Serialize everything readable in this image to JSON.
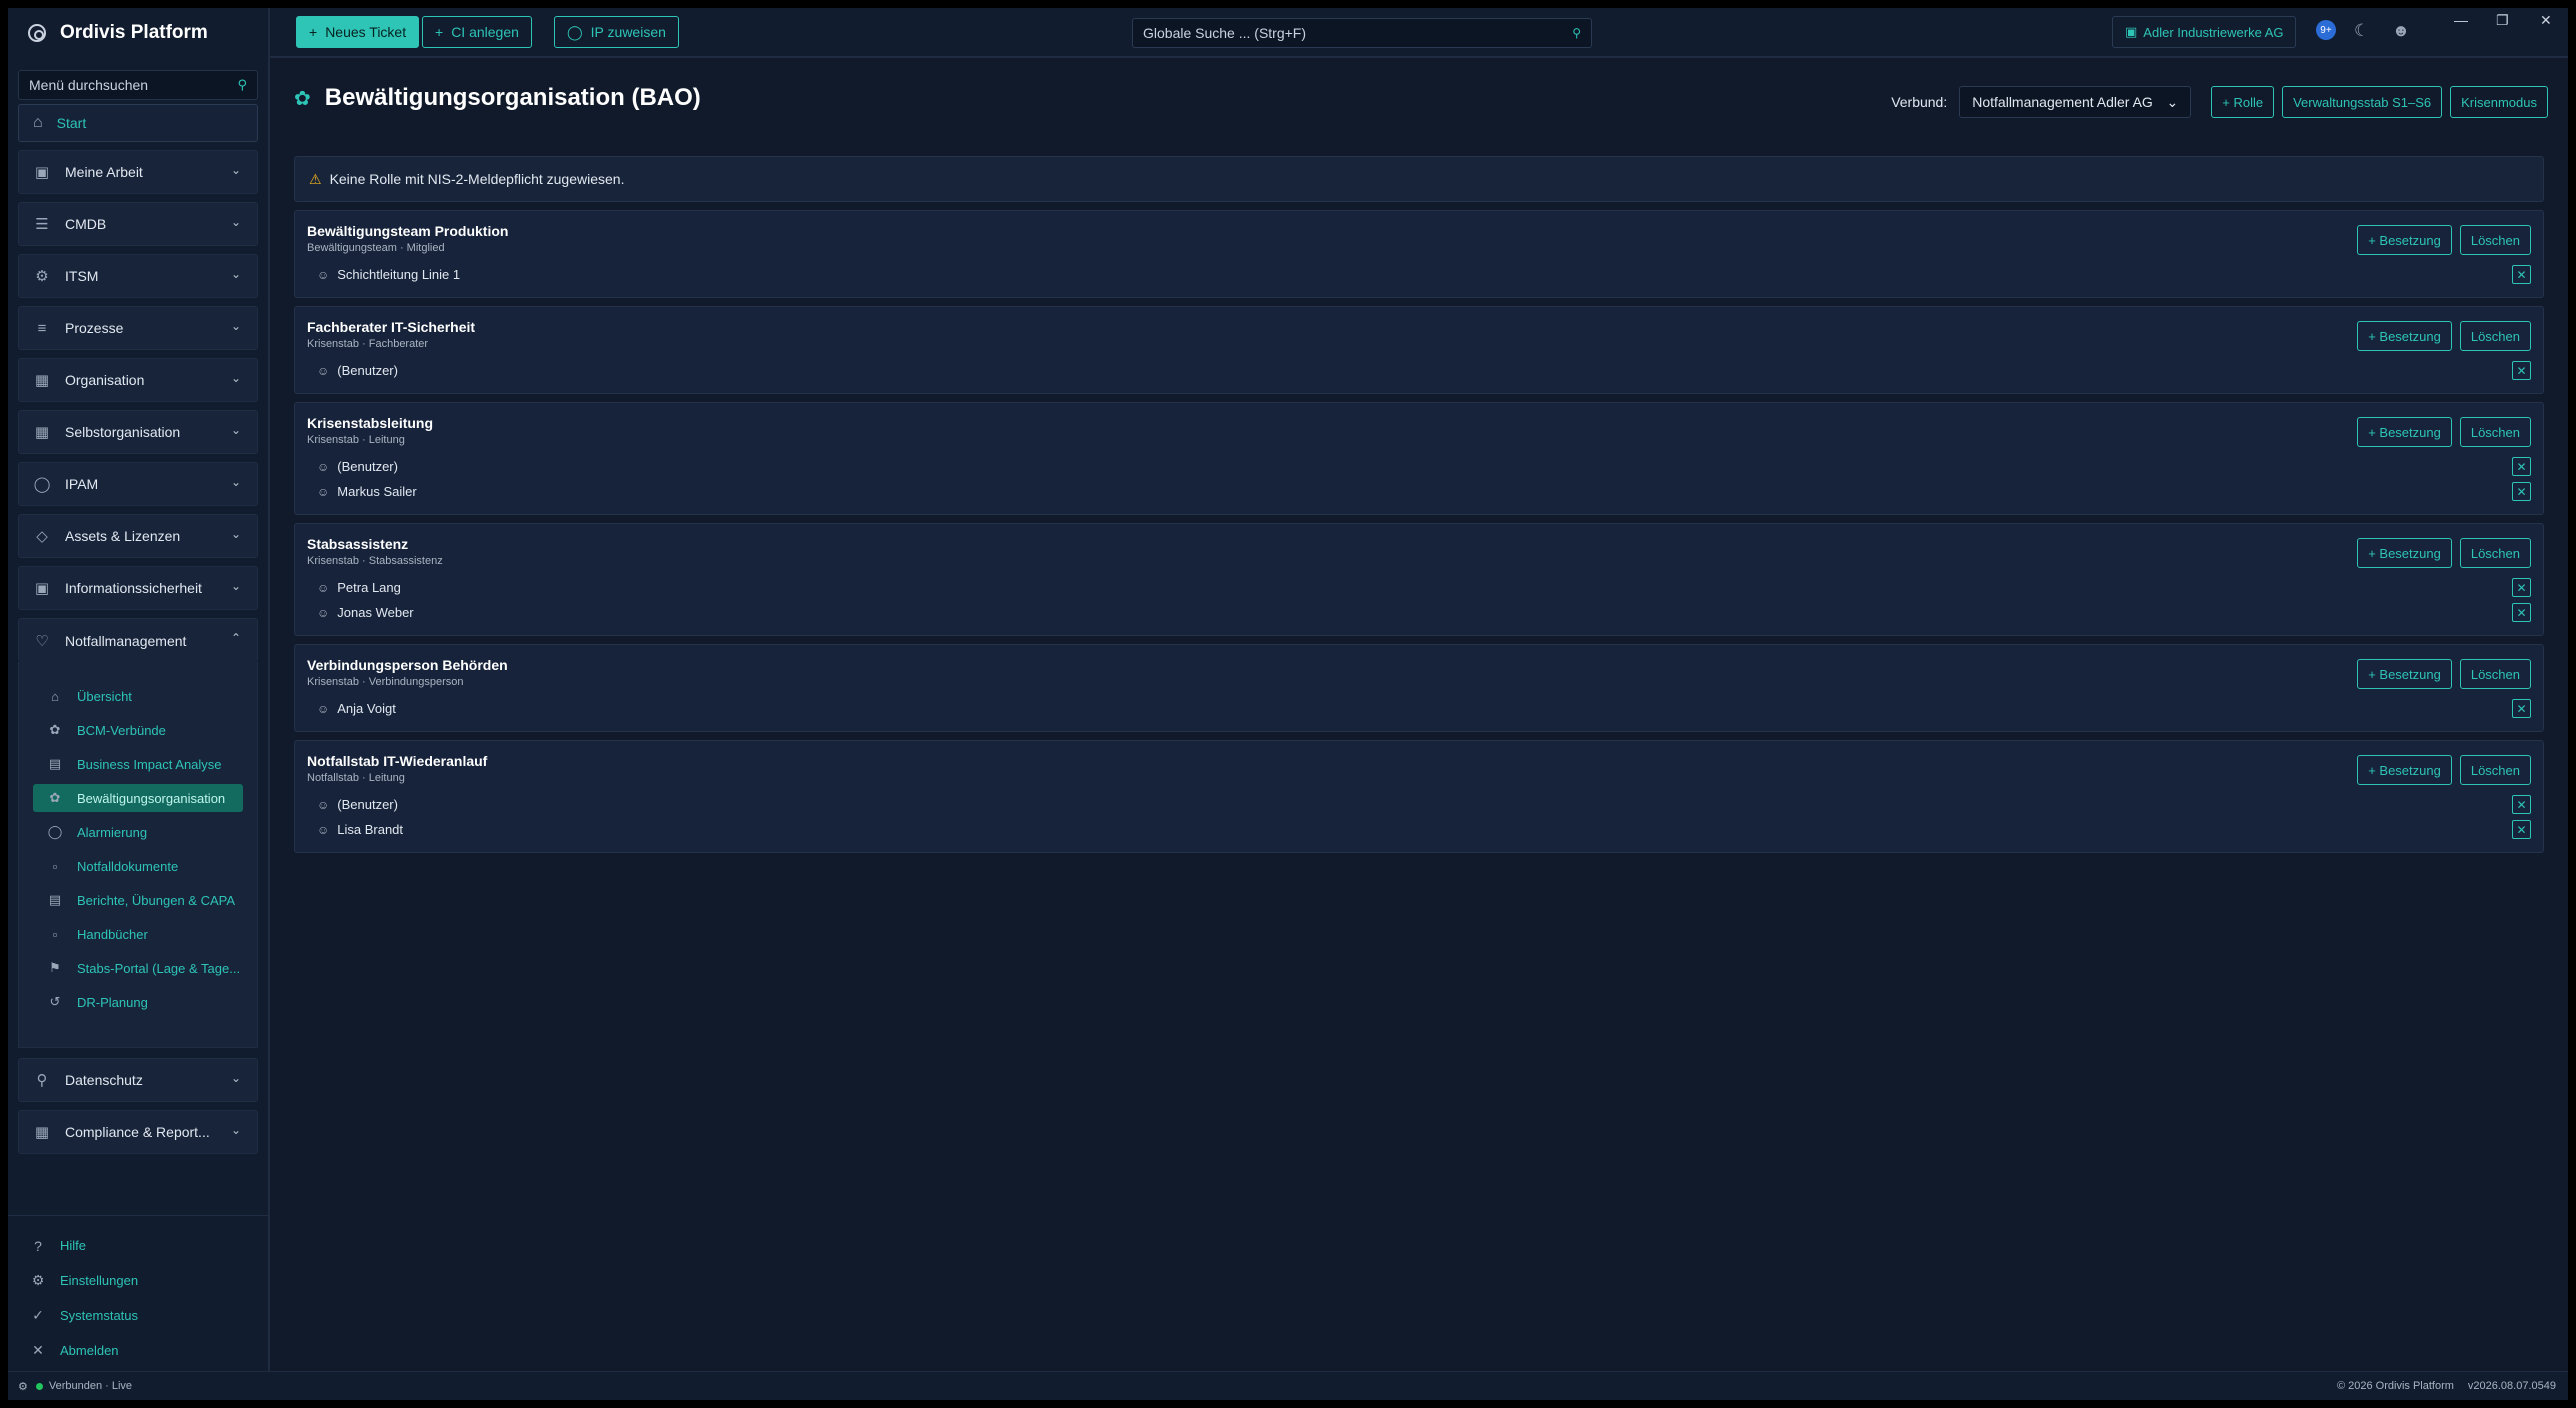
{
  "app": {
    "title": "Ordivis Platform"
  },
  "sidebar": {
    "search_placeholder": "Menü durchsuchen",
    "start": "Start",
    "groups": [
      {
        "label": "Meine Arbeit",
        "icon": "briefcase-icon"
      },
      {
        "label": "CMDB",
        "icon": "list-icon"
      },
      {
        "label": "ITSM",
        "icon": "wrench-icon"
      },
      {
        "label": "Prozesse",
        "icon": "process-icon"
      },
      {
        "label": "Organisation",
        "icon": "books-icon"
      },
      {
        "label": "Selbstorganisation",
        "icon": "calendar-icon"
      },
      {
        "label": "IPAM",
        "icon": "globe-icon"
      },
      {
        "label": "Assets & Lizenzen",
        "icon": "tag-icon"
      },
      {
        "label": "Informationssicherheit",
        "icon": "lock-icon"
      },
      {
        "label": "Notfallmanagement",
        "icon": "bell-icon"
      }
    ],
    "notfall_items": [
      "Übersicht",
      "BCM-Verbünde",
      "Business Impact Analyse",
      "Bewältigungsorganisation",
      "Alarmierung",
      "Notfalldokumente",
      "Berichte, Übungen & CAPA",
      "Handbücher",
      "Stabs-Portal (Lage & Tage...",
      "DR-Planung"
    ],
    "groups_after": [
      {
        "label": "Datenschutz",
        "icon": "key-icon"
      },
      {
        "label": "Compliance & Report...",
        "icon": "report-icon"
      }
    ],
    "footer": [
      "Hilfe",
      "Einstellungen",
      "Systemstatus",
      "Abmelden"
    ]
  },
  "topbar": {
    "new_ticket": "Neues Ticket",
    "ci_anlegen": "CI anlegen",
    "ip_zuweisen": "IP zuweisen",
    "search_placeholder": "Globale Suche ... (Strg+F)",
    "tenant": "Adler Industriewerke AG",
    "badge": "9+"
  },
  "page": {
    "title": "Bewältigungsorganisation (BAO)",
    "verbund_label": "Verbund:",
    "verbund_value": "Notfallmanagement Adler AG",
    "btn_rolle": "+ Rolle",
    "btn_verwaltungsstab": "Verwaltungsstab S1–S6",
    "btn_krisenmodus": "Krisenmodus",
    "alert": "Keine Rolle mit NIS-2-Meldepflicht zugewiesen.",
    "btn_besetzung": "+ Besetzung",
    "btn_loeschen": "Löschen",
    "roles": [
      {
        "title": "Bewältigungsteam Produktion",
        "subtitle": "Bewältigungsteam · Mitglied",
        "members": [
          "Schichtleitung Linie 1"
        ]
      },
      {
        "title": "Fachberater IT-Sicherheit",
        "subtitle": "Krisenstab · Fachberater",
        "members": [
          "(Benutzer)"
        ]
      },
      {
        "title": "Krisenstabsleitung",
        "subtitle": "Krisenstab · Leitung",
        "members": [
          "(Benutzer)",
          "Markus Sailer"
        ]
      },
      {
        "title": "Stabsassistenz",
        "subtitle": "Krisenstab · Stabsassistenz",
        "members": [
          "Petra Lang",
          "Jonas Weber"
        ]
      },
      {
        "title": "Verbindungsperson Behörden",
        "subtitle": "Krisenstab · Verbindungsperson",
        "members": [
          "Anja Voigt"
        ]
      },
      {
        "title": "Notfallstab IT-Wiederanlauf",
        "subtitle": "Notfallstab · Leitung",
        "members": [
          "(Benutzer)",
          "Lisa Brandt"
        ]
      }
    ]
  },
  "statusbar": {
    "connection": "Verbunden · Live",
    "copyright": "© 2026 Ordivis Platform",
    "version": "v2026.08.07.0549"
  },
  "colors": {
    "accent": "#2ec4b6",
    "background": "#101a2b",
    "warning": "#f2b01e",
    "online": "#22c55e"
  }
}
